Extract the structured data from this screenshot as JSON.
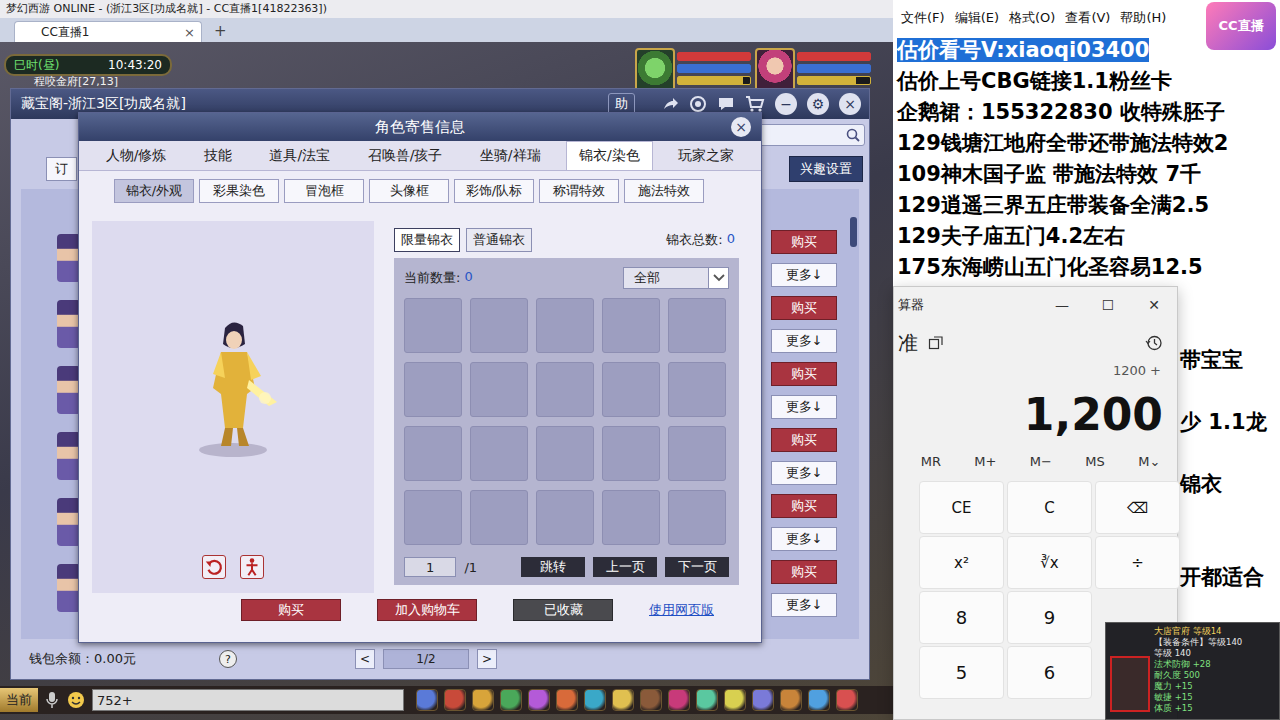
{
  "app": {
    "title": "梦幻西游 ONLINE - (浙江3区[功成名就] - CC直播1[41822363])"
  },
  "browser_tabs": [
    {
      "label": "CC直播1",
      "close": "×",
      "selected": true
    }
  ],
  "new_tab": "+",
  "hud": {
    "period": "巳时(昼)",
    "clock": "10:43:20",
    "location": "程咬金府[27,13]"
  },
  "portraits": [
    {
      "bars": [
        {
          "level": 1,
          "color": "#d23a3a"
        },
        {
          "level": 1,
          "color": "#3a6fd2"
        },
        {
          "level": 0.9,
          "color": "#d2b23a"
        }
      ]
    },
    {
      "bars": [
        {
          "level": 1,
          "color": "#d23a3a"
        },
        {
          "level": 1,
          "color": "#3a6fd2"
        },
        {
          "level": 0.8,
          "color": "#d2b23a"
        }
      ]
    }
  ],
  "cbg": {
    "title": "藏宝阁-浙江3区[功成名就]",
    "help": "助",
    "controls": [
      "−",
      "⚙",
      "×"
    ],
    "order_button": "订",
    "interest_button": "兴趣设置",
    "rows": [
      {
        "buy": "购买",
        "more": "更多↓"
      },
      {
        "buy": "购买",
        "more": "更多↓"
      },
      {
        "buy": "购买",
        "more": "更多↓"
      },
      {
        "buy": "购买",
        "more": "更多↓"
      },
      {
        "buy": "购买",
        "more": "更多↓"
      },
      {
        "buy": "购买",
        "more": "更多↓"
      }
    ],
    "wallet": "钱包余额：0.00元",
    "help_badge": "?",
    "pager": {
      "prev": "<",
      "page": "1/2",
      "next": ">"
    }
  },
  "dialog": {
    "title": "角色寄售信息",
    "close": "×",
    "tabs": [
      {
        "label": "人物/修炼",
        "selected": false
      },
      {
        "label": "技能",
        "selected": false
      },
      {
        "label": "道具/法宝",
        "selected": false
      },
      {
        "label": "召唤兽/孩子",
        "selected": false
      },
      {
        "label": "坐骑/祥瑞",
        "selected": false
      },
      {
        "label": "锦衣/染色",
        "selected": true
      },
      {
        "label": "玩家之家",
        "selected": false
      }
    ],
    "subtabs": [
      {
        "label": "锦衣/外观",
        "selected": true
      },
      {
        "label": "彩果染色",
        "selected": false
      },
      {
        "label": "冒泡框",
        "selected": false
      },
      {
        "label": "头像框",
        "selected": false
      },
      {
        "label": "彩饰/队标",
        "selected": false
      },
      {
        "label": "称谓特效",
        "selected": false
      },
      {
        "label": "施法特效",
        "selected": false
      }
    ],
    "costume_types": [
      {
        "label": "限量锦衣",
        "selected": true
      },
      {
        "label": "普通锦衣",
        "selected": false
      }
    ],
    "total_label": "锦衣总数:",
    "total": "0",
    "count_label": "当前数量:",
    "count": "0",
    "filter": "全部",
    "slots": [
      {
        "filled": false
      },
      {
        "filled": false
      },
      {
        "filled": false
      },
      {
        "filled": false
      },
      {
        "filled": false
      },
      {
        "filled": false
      },
      {
        "filled": false
      },
      {
        "filled": false
      },
      {
        "filled": false
      },
      {
        "filled": false
      },
      {
        "filled": false
      },
      {
        "filled": false
      },
      {
        "filled": false
      },
      {
        "filled": false
      },
      {
        "filled": false
      },
      {
        "filled": false
      },
      {
        "filled": false
      },
      {
        "filled": false
      },
      {
        "filled": false
      },
      {
        "filled": false
      }
    ],
    "pager": {
      "page": "1",
      "total": "/1",
      "jump": "跳转",
      "prev": "上一页",
      "next": "下一页"
    },
    "actions": [
      {
        "label": "购买",
        "kind": "red"
      },
      {
        "label": "加入购物车",
        "kind": "red"
      },
      {
        "label": "已收藏",
        "kind": "grey"
      },
      {
        "label": "使用网页版",
        "kind": "link"
      }
    ]
  },
  "chat": {
    "channel": "当前",
    "input": "752+"
  },
  "notepad": {
    "menu": [
      "文件(F)",
      "编辑(E)",
      "格式(O)",
      "查看(V)",
      "帮助(H)"
    ],
    "lines": [
      {
        "text": "估价看号V:xiaoqi03400",
        "kind": "full",
        "selected": true
      },
      {
        "text": "估价上号CBG链接1.1粉丝卡",
        "kind": "full",
        "selected": false
      },
      {
        "text": "企鹅裙：155322830 收特殊胚子",
        "kind": "full",
        "selected": false
      },
      {
        "text": "129钱塘江地府全带还带施法特效2",
        "kind": "full",
        "selected": false
      },
      {
        "text": "109神木国子监 带施法特效 7千",
        "kind": "full",
        "selected": false
      },
      {
        "text": "129逍遥三界五庄带装备全满2.5",
        "kind": "full",
        "selected": false
      },
      {
        "text": "129夫子庙五门4.2左右",
        "kind": "full",
        "selected": false
      },
      {
        "text": "175东海崂山五门化圣容易12.5",
        "kind": "full",
        "selected": false
      },
      {
        "text": "",
        "kind": "covered",
        "selected": false
      },
      {
        "text": "",
        "kind": "covered",
        "selected": false
      },
      {
        "text": "带宝宝",
        "kind": "tail",
        "selected": false
      },
      {
        "text": "",
        "kind": "covered",
        "selected": false
      },
      {
        "text": "少 1.1龙",
        "kind": "tail",
        "selected": false
      },
      {
        "text": "",
        "kind": "covered",
        "selected": false
      },
      {
        "text": "锦衣",
        "kind": "tail",
        "selected": false
      },
      {
        "text": "",
        "kind": "covered",
        "selected": false
      },
      {
        "text": "",
        "kind": "covered",
        "selected": false
      },
      {
        "text": "开都适合",
        "kind": "tail",
        "selected": false
      }
    ]
  },
  "calculator": {
    "title": "算器",
    "controls": [
      "—",
      "☐",
      "✕"
    ],
    "mode": "准",
    "expression": "1200 +",
    "display": "1,200",
    "memory": [
      "MR",
      "M+",
      "M−",
      "MS",
      "M⌄"
    ],
    "keys": [
      [
        "CE",
        "C",
        "⌫"
      ],
      [
        "x²",
        "∛x",
        "÷"
      ],
      [
        "8",
        "9"
      ],
      [
        "5",
        "6"
      ]
    ]
  },
  "cc_logo": {
    "label": "CC直播"
  },
  "tooltip": {
    "lines": [
      "大唐官府 等级14",
      "【装备条件】等级140",
      "等级 140",
      "法术防御 +28",
      "耐久度 500",
      "魔力 +15",
      "敏捷 +15",
      "体质 +15"
    ]
  }
}
